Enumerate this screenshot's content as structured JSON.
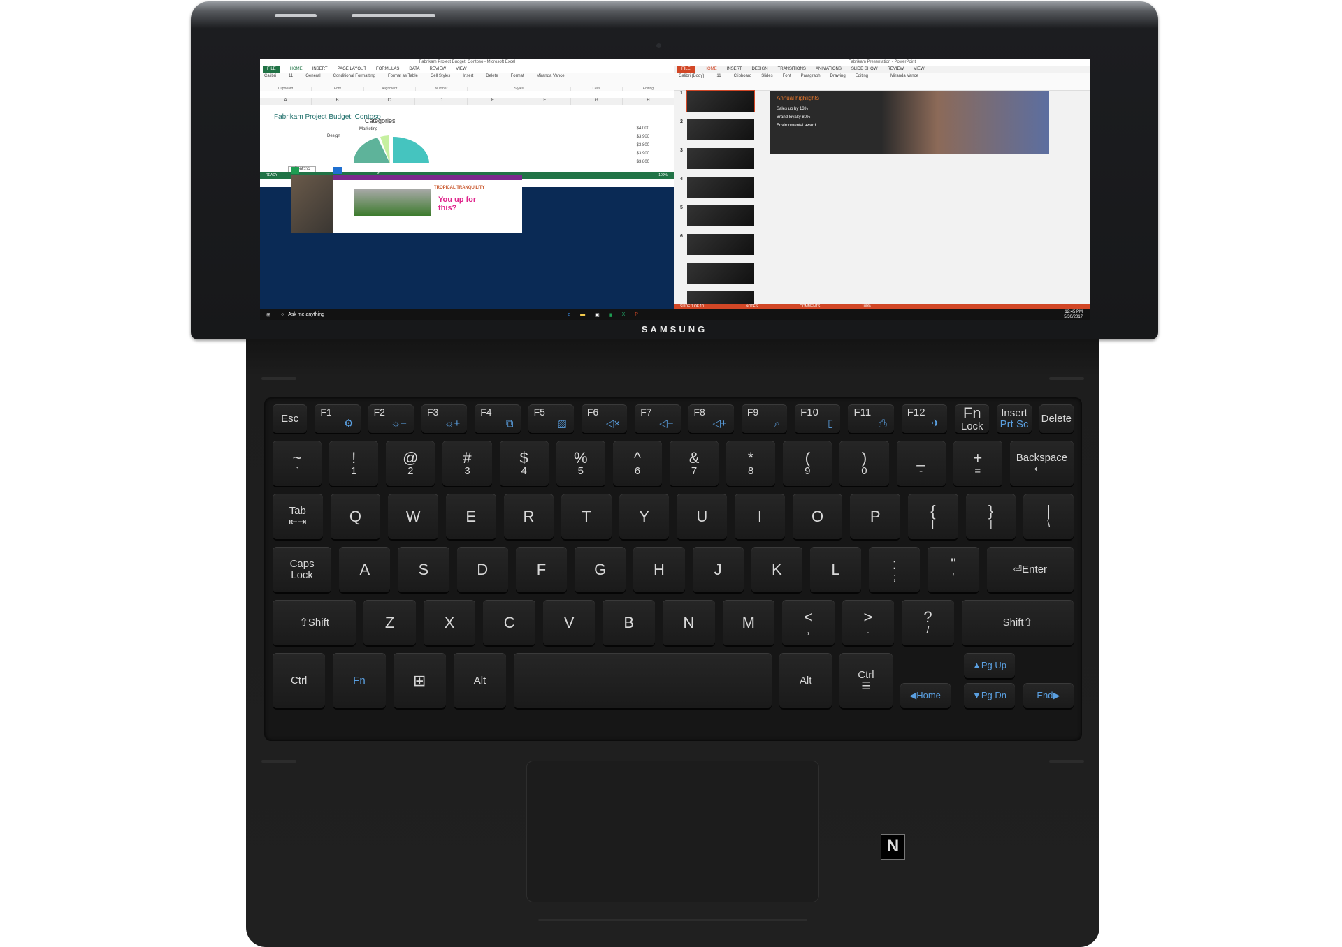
{
  "device": {
    "brand": "SAMSUNG",
    "nfc_mark": "N"
  },
  "excel": {
    "title": "Fabrikam Project Budget: Contoso  -  Microsoft Excel",
    "tabs": [
      "FILE",
      "HOME",
      "INSERT",
      "PAGE LAYOUT",
      "FORMULAS",
      "DATA",
      "REVIEW",
      "VIEW"
    ],
    "user": "Miranda Vance",
    "ribbon_groups": [
      "Clipboard",
      "Font",
      "Alignment",
      "Number",
      "Styles",
      "Cells",
      "Editing"
    ],
    "style_items": [
      "Conditional Formatting",
      "Format as Table",
      "Cell Styles"
    ],
    "cell_items": [
      "Insert",
      "Delete",
      "Format"
    ],
    "font": "Calibri",
    "font_size": "11",
    "number_format": "General",
    "columns": [
      "A",
      "B",
      "C",
      "D",
      "E",
      "F",
      "G",
      "H"
    ],
    "sheet_title": "Fabrikam Project Budget: Contoso",
    "chart_title": "Categories",
    "pie_labels": [
      "Marketing",
      "Design"
    ],
    "h_values": [
      "$4,000",
      "$3,900",
      "$3,800",
      "$3,900",
      "$3,800"
    ],
    "sheet_tab": "Contoso",
    "status": "READY",
    "zoom": "100%"
  },
  "task_view": {
    "windows": [
      {
        "label": "MSN..."
      },
      {
        "label": "Microsoft Edge",
        "page_heading": "TROPICAL TRANQUILITY",
        "handwriting": "You up for this?"
      }
    ]
  },
  "ppt": {
    "title": "Fabrikam Presentation  -  PowerPoint",
    "tabs": [
      "FILE",
      "HOME",
      "INSERT",
      "DESIGN",
      "TRANSITIONS",
      "ANIMATIONS",
      "SLIDE SHOW",
      "REVIEW",
      "VIEW"
    ],
    "user": "Miranda Vance",
    "ribbon_groups": [
      "Clipboard",
      "Slides",
      "Font",
      "Paragraph",
      "Drawing",
      "Editing"
    ],
    "font": "Calibri (Body)",
    "font_size": "11",
    "slide_numbers": [
      "1",
      "2",
      "3",
      "4",
      "5",
      "6",
      "",
      ""
    ],
    "slide": {
      "heading": "Annual highlights",
      "items": [
        "Sales up by 13%",
        "Brand loyalty 80%",
        "Environmental award"
      ]
    },
    "status": {
      "slide": "SLIDE 1 OF 10",
      "notes": "NOTES",
      "comments": "COMMENTS",
      "zoom": "100%"
    }
  },
  "taskbar": {
    "search_placeholder": "Ask me anything",
    "time": "12:45 PM",
    "date": "5/30/2017"
  },
  "keyboard": {
    "accent": "#5a9fe0",
    "rows": [
      [
        {
          "t": "Esc"
        },
        {
          "t": "F1",
          "ic": "gear"
        },
        {
          "t": "F2",
          "ic": "brightness-down"
        },
        {
          "t": "F3",
          "ic": "brightness-up"
        },
        {
          "t": "F4",
          "ic": "display-switch"
        },
        {
          "t": "F5",
          "ic": "touchpad-off"
        },
        {
          "t": "F6",
          "ic": "mute"
        },
        {
          "t": "F7",
          "ic": "volume-down"
        },
        {
          "t": "F8",
          "ic": "volume-up"
        },
        {
          "t": "F9",
          "ic": "search"
        },
        {
          "t": "F10",
          "ic": "screen"
        },
        {
          "t": "F11",
          "ic": "screenshot"
        },
        {
          "t": "F12",
          "ic": "airplane"
        },
        {
          "t": "Fn",
          "b": "Lock"
        },
        {
          "t": "Insert",
          "blue": "Prt Sc"
        },
        {
          "t": "Delete"
        }
      ],
      [
        {
          "t": "~",
          "b": "`"
        },
        {
          "t": "!",
          "b": "1"
        },
        {
          "t": "@",
          "b": "2"
        },
        {
          "t": "#",
          "b": "3"
        },
        {
          "t": "$",
          "b": "4"
        },
        {
          "t": "%",
          "b": "5"
        },
        {
          "t": "^",
          "b": "6"
        },
        {
          "t": "&",
          "b": "7"
        },
        {
          "t": "*",
          "b": "8"
        },
        {
          "t": "(",
          "b": "9"
        },
        {
          "t": ")",
          "b": "0"
        },
        {
          "t": "_",
          "b": "-"
        },
        {
          "t": "+",
          "b": "="
        },
        {
          "t": "Backspace",
          "b": "⟵",
          "w": 1.3
        }
      ],
      [
        {
          "t": "Tab",
          "b": "⇤⇥"
        },
        {
          "t": "Q"
        },
        {
          "t": "W"
        },
        {
          "t": "E"
        },
        {
          "t": "R"
        },
        {
          "t": "T"
        },
        {
          "t": "Y"
        },
        {
          "t": "U"
        },
        {
          "t": "I"
        },
        {
          "t": "O"
        },
        {
          "t": "P"
        },
        {
          "t": "{",
          "b": "["
        },
        {
          "t": "}",
          "b": "]"
        },
        {
          "t": "|",
          "b": "\\"
        }
      ],
      [
        {
          "t": "Caps",
          "b": "Lock",
          "w": 1.15
        },
        {
          "t": "A"
        },
        {
          "t": "S"
        },
        {
          "t": "D"
        },
        {
          "t": "F"
        },
        {
          "t": "G"
        },
        {
          "t": "H"
        },
        {
          "t": "J"
        },
        {
          "t": "K"
        },
        {
          "t": "L"
        },
        {
          "t": ":",
          "b": ";"
        },
        {
          "t": "\"",
          "b": "'"
        },
        {
          "t": "⏎Enter",
          "w": 1.7
        }
      ],
      [
        {
          "t": "⇧Shift",
          "w": 1.6
        },
        {
          "t": "Z"
        },
        {
          "t": "X"
        },
        {
          "t": "C"
        },
        {
          "t": "V"
        },
        {
          "t": "B"
        },
        {
          "t": "N"
        },
        {
          "t": "M"
        },
        {
          "t": "<",
          "b": ","
        },
        {
          "t": ">",
          "b": "."
        },
        {
          "t": "?",
          "b": "/"
        },
        {
          "t": "Shift⇧",
          "w": 2.15
        }
      ],
      [
        {
          "t": "Ctrl"
        },
        {
          "t": "Fn",
          "blue_only": true
        },
        {
          "t": "⊞",
          "ic": "windows"
        },
        {
          "t": "Alt"
        },
        {
          "t": "",
          "w": 4.9,
          "name": "space"
        },
        {
          "t": "Alt"
        },
        {
          "t": "Ctrl",
          "b": "☰"
        }
      ]
    ],
    "nav": {
      "pgup": "▲Pg Up",
      "pgdn": "▼Pg Dn",
      "home": "◀Home",
      "end": "End▶"
    }
  }
}
